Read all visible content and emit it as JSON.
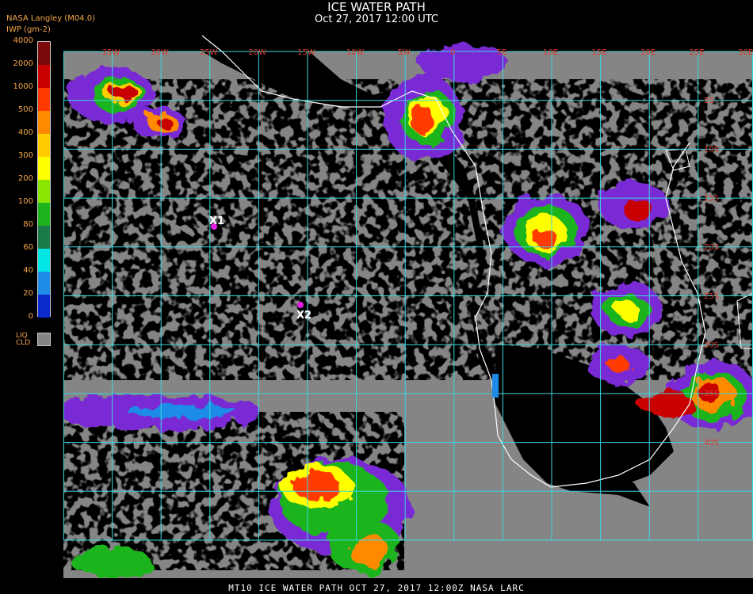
{
  "header": {
    "title": "ICE WATER PATH",
    "subtitle": "Oct 27, 2017 12:00 UTC",
    "source": "NASA Langley (M04.0)",
    "units": "IWP (gm-2)"
  },
  "legend": {
    "ticks": [
      "4000",
      "2000",
      "1000",
      "500",
      "400",
      "300",
      "200",
      "100",
      "80",
      "60",
      "40",
      "20",
      "0"
    ],
    "colors": [
      "#7a0a0a",
      "#c80000",
      "#ff3a00",
      "#ff8a00",
      "#ffcc00",
      "#ffff00",
      "#8ae600",
      "#1eb41e",
      "#1a7a4a",
      "#00e6e6",
      "#1e8ce6",
      "#0a2acc",
      "#7a2ad4"
    ],
    "liq_label_1": "LIQ",
    "liq_label_2": "CLD",
    "liq_color": "#858585"
  },
  "map": {
    "lon_labels": [
      "35W",
      "30W",
      "25W",
      "20W",
      "15W",
      "10W",
      "5W",
      "0",
      "5E",
      "10E",
      "15E",
      "20E",
      "25E",
      "30E",
      "35E"
    ],
    "lat_labels": [
      "5S",
      "10S",
      "15S",
      "20S",
      "25S",
      "30S",
      "35S",
      "40S"
    ],
    "markers": [
      {
        "label": "X1",
        "color": "#e61ee6"
      },
      {
        "label": "X2",
        "color": "#e61ee6"
      }
    ],
    "colors": {
      "ocean": "#858585",
      "clear": "#000000",
      "grid": "#3ad8e0",
      "coast": "#ffffff"
    }
  },
  "footer": {
    "text": "MT10  ICE WATER PATH  OCT 27, 2017 12:00Z  NASA LARC"
  }
}
